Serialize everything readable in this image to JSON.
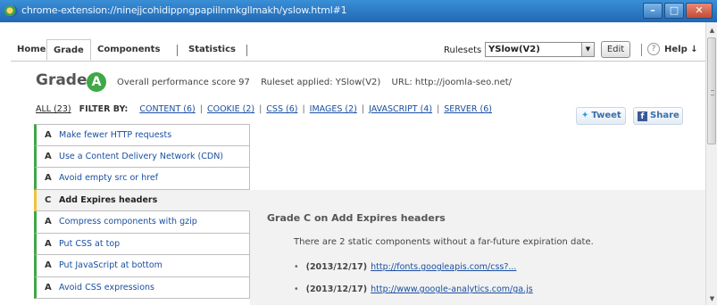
{
  "window": {
    "title": "chrome-extension://ninejjcohidippngpapiilnmkgllmakh/yslow.html#1",
    "controls": {
      "minimize": "–",
      "maximize": "□",
      "close": "✕"
    }
  },
  "nav": {
    "tabs": [
      {
        "label": "Home"
      },
      {
        "label": "Grade",
        "active": true
      },
      {
        "label": "Components"
      },
      {
        "label": "Statistics"
      }
    ],
    "rulesets_label": "Rulesets",
    "rulesets_value": "YSlow(V2)",
    "edit_label": "Edit",
    "help_icon": "?",
    "help_label": "Help ↓"
  },
  "grade": {
    "word": "Grade",
    "letter": "A",
    "score_text": "Overall performance score 97",
    "ruleset_text": "Ruleset applied: YSlow(V2)",
    "url_text": "URL: http://joomla-seo.net/"
  },
  "filter": {
    "all": "ALL (23)",
    "filter_by": "FILTER BY:",
    "links": [
      "CONTENT (6)",
      "COOKIE (2)",
      "CSS (6)",
      "IMAGES (2)",
      "JAVASCRIPT (4)",
      "SERVER (6)"
    ],
    "tweet": "Tweet",
    "share": "Share",
    "facebook_glyph": "f"
  },
  "rules": [
    {
      "grade": "A",
      "label": "Make fewer HTTP requests"
    },
    {
      "grade": "A",
      "label": "Use a Content Delivery Network (CDN)"
    },
    {
      "grade": "A",
      "label": "Avoid empty src or href"
    },
    {
      "grade": "C",
      "label": "Add Expires headers",
      "selected": true
    },
    {
      "grade": "A",
      "label": "Compress components with gzip"
    },
    {
      "grade": "A",
      "label": "Put CSS at top"
    },
    {
      "grade": "A",
      "label": "Put JavaScript at bottom"
    },
    {
      "grade": "A",
      "label": "Avoid CSS expressions"
    }
  ],
  "detail": {
    "title": "Grade C on Add Expires headers",
    "description": "There are 2 static components without a far-future expiration date.",
    "components": [
      {
        "date": "(2013/12/17)",
        "url": "http://fonts.googleapis.com/css?..."
      },
      {
        "date": "(2013/12/17)",
        "url": "http://www.google-analytics.com/ga.js"
      }
    ]
  },
  "colors": {
    "grade_a": "#3fa847",
    "grade_c": "#f2c23a",
    "link": "#1a4fa0",
    "titlebar": "#2a77c4"
  }
}
